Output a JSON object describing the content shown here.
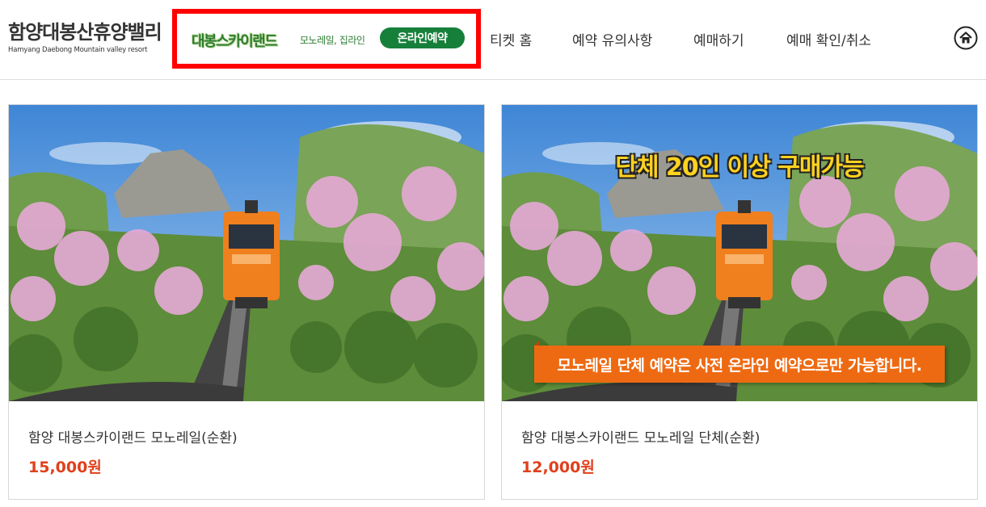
{
  "header": {
    "logo_title": "함양대봉산휴양밸리",
    "logo_subtitle": "Hamyang Daebong Mountain valley resort",
    "promo": {
      "name": "대봉스카이랜드",
      "subtitle": "모노레일, 집라인",
      "button_label": "온라인예약",
      "brand_color": "#16803a",
      "highlight_color": "#ff0000"
    },
    "nav": [
      "티켓 홈",
      "예약 유의사항",
      "예매하기",
      "예매 확인/취소"
    ],
    "home_icon": "home-icon"
  },
  "products": [
    {
      "title": "함양 대봉스카이랜드 모노레일(순환)",
      "price": "15,000원",
      "overlay_top": "",
      "overlay_band": ""
    },
    {
      "title": "함양 대봉스카이랜드 모노레일 단체(순환)",
      "price": "12,000원",
      "overlay_top": "단체 20인 이상 구매가능",
      "overlay_band": "모노레일 단체 예약은 사전 온라인 예약으로만 가능합니다."
    }
  ],
  "colors": {
    "price": "#e0401c",
    "accent_orange": "#ee6a12",
    "overlay_yellow": "#ffd21f"
  }
}
